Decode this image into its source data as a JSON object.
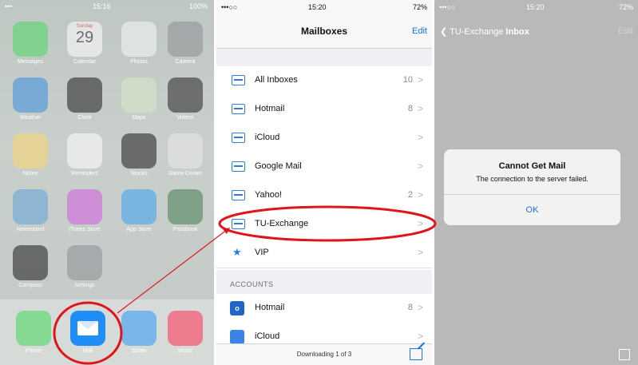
{
  "home": {
    "status": {
      "carrier": "•••",
      "time": "15:16",
      "battery": "100%"
    },
    "apps": [
      {
        "label": "Messages",
        "color": "#4cd964"
      },
      {
        "label": "Calendar",
        "day": "Sunday",
        "date": "29",
        "color": "#ffffff"
      },
      {
        "label": "Photos",
        "color": "#f6f6f6"
      },
      {
        "label": "Camera",
        "color": "#8e8e93"
      },
      {
        "label": "Weather",
        "color": "#3b8ee0"
      },
      {
        "label": "Clock",
        "color": "#1c1c1c"
      },
      {
        "label": "Maps",
        "color": "#d6e9c6"
      },
      {
        "label": "Videos",
        "color": "#222222"
      },
      {
        "label": "Notes",
        "color": "#fcd56b"
      },
      {
        "label": "Reminders",
        "color": "#ffffff"
      },
      {
        "label": "Stocks",
        "color": "#1c1c1c"
      },
      {
        "label": "Game Center",
        "color": "#e9e9e9"
      },
      {
        "label": "Newsstand",
        "color": "#5ea3d8"
      },
      {
        "label": "iTunes Store",
        "color": "#d25be0"
      },
      {
        "label": "App Store",
        "color": "#3aa0f2"
      },
      {
        "label": "Passbook",
        "color": "#3f7c4f"
      },
      {
        "label": "Compass",
        "color": "#1c1c1c"
      },
      {
        "label": "Settings",
        "color": "#8e8e93"
      }
    ],
    "dock": [
      {
        "label": "Phone",
        "color": "#4cd964"
      },
      {
        "label": "Mail",
        "color": "#1f8ef7"
      },
      {
        "label": "Safari",
        "color": "#3a9cf6"
      },
      {
        "label": "Music",
        "color": "#fc3d5c"
      }
    ]
  },
  "mailboxes": {
    "status": {
      "carrier": "•••○○",
      "time": "15:20",
      "battery": "72%"
    },
    "title": "Mailboxes",
    "edit": "Edit",
    "rows": [
      {
        "label": "All Inboxes",
        "count": "10"
      },
      {
        "label": "Hotmail",
        "count": "8"
      },
      {
        "label": "iCloud",
        "count": ""
      },
      {
        "label": "Google Mail",
        "count": ""
      },
      {
        "label": "Yahoo!",
        "count": "2"
      },
      {
        "label": "TU-Exchange",
        "count": ""
      },
      {
        "label": "VIP",
        "count": ""
      }
    ],
    "section_header": "ACCOUNTS",
    "accounts": [
      {
        "label": "Hotmail",
        "count": "8",
        "icon": "o"
      },
      {
        "label": "iCloud",
        "count": "",
        "icon": ""
      }
    ],
    "toolbar_text": "Downloading 1 of 3",
    "chevron": ">"
  },
  "inbox": {
    "status": {
      "carrier": "•••○○",
      "time": "15:20",
      "battery": "72%"
    },
    "back_account": "TU-Exchange",
    "back_title": "Inbox",
    "edit": "Edit",
    "alert_title": "Cannot Get Mail",
    "alert_message": "The connection to the server failed.",
    "alert_button": "OK"
  },
  "colors": {
    "highlight": "#e0151b",
    "accent": "#1a73e8"
  }
}
